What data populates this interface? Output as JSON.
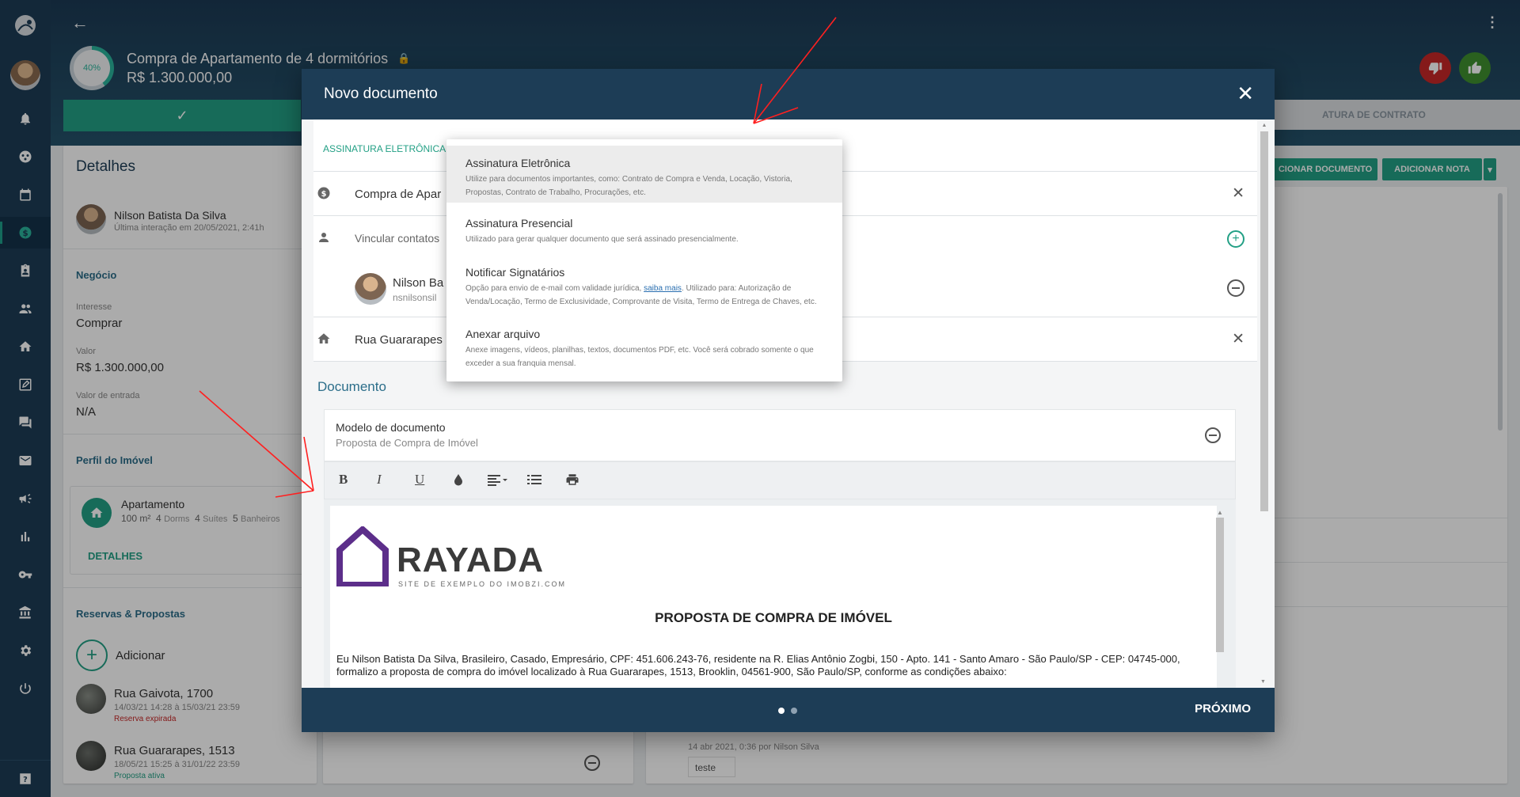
{
  "deal": {
    "title": "Compra de Apartamento de 4 dormitórios",
    "value": "R$ 1.300.000,00",
    "progress": "40%",
    "progress_value": 40
  },
  "topbar_tab_right": "ATURA DE CONTRATO",
  "buttons": {
    "add_document_partial": "CIONAR DOCUMENTO",
    "add_note": "ADICIONAR NOTA"
  },
  "details": {
    "heading": "Detalhes",
    "contact_name": "Nilson Batista Da Silva",
    "last_interaction": "Última interação em 20/05/2021, 2:41h",
    "business_heading": "Negócio",
    "interest_label": "Interesse",
    "interest_value": "Comprar",
    "value_label": "Valor",
    "value_value": "R$ 1.300.000,00",
    "entry_label": "Valor de entrada",
    "entry_value": "N/A",
    "profile_heading": "Perfil do Imóvel",
    "property_type": "Apartamento",
    "property_area": "100 m²",
    "dorms_n": "4",
    "dorms_l": "Dorms",
    "suites_n": "4",
    "suites_l": "Suítes",
    "baths_n": "5",
    "baths_l": "Banheiros",
    "details_link": "DETALHES",
    "reservations_heading": "Reservas & Propostas",
    "add_label": "Adicionar",
    "reservations": [
      {
        "address": "Rua Gaivota, 1700",
        "dates": "14/03/21 14:28 à 15/03/21 23:59",
        "status": "Reserva expirada"
      },
      {
        "address": "Rua Guararapes, 1513",
        "dates": "18/05/21 15:25 à 31/01/22 23:59",
        "status": "Proposta ativa"
      }
    ]
  },
  "timeline": {
    "meta": "14 abr 2021, 0:36 por Nilson Silva",
    "note": "teste"
  },
  "modal": {
    "title": "Novo documento",
    "tab_label": "ASSINATURA ELETRÔNICA",
    "deal_row": "Compra de Apar",
    "link_contacts": "Vincular contatos",
    "contact_name": "Nilson Ba",
    "contact_email": "nsnilsonsil",
    "property_row": "Rua Guararapes",
    "document_heading": "Documento",
    "template_label": "Modelo de documento",
    "template_value": "Proposta de Compra de Imóvel",
    "next_label": "PRÓXIMO"
  },
  "toolbar": {
    "bold": "B",
    "italic": "I",
    "underline": "U"
  },
  "document": {
    "brand": "RAYADA",
    "brand_tagline": "SITE DE EXEMPLO DO IMOBZI.COM",
    "heading": "PROPOSTA DE COMPRA DE IMÓVEL",
    "paragraph": "Eu Nilson Batista Da Silva, Brasileiro, Casado, Empresário, CPF: 451.606.243-76, residente na R. Elias Antônio Zogbi, 150 - Apto. 141 - Santo Amaro - São Paulo/SP - CEP: 04745-000, formalizo a proposta de compra do imóvel localizado à Rua Guararapes, 1513, Brooklin, 04561-900, São Paulo/SP, conforme as condições abaixo:"
  },
  "dropdown": {
    "items": [
      {
        "title": "Assinatura Eletrônica",
        "desc": "Utilize para documentos importantes, como: Contrato de Compra e Venda, Locação, Vistoria, Propostas, Contrato de Trabalho, Procurações, etc."
      },
      {
        "title": "Assinatura Presencial",
        "desc": "Utilizado para gerar qualquer documento que será assinado presencialmente."
      },
      {
        "title": "Notificar Signatários",
        "desc_before": "Opção para envio de e-mail com validade jurídica, ",
        "desc_link": "saiba mais",
        "desc_after": ". Utilizado para: Autorização de Venda/Locação, Termo de Exclusividade, Comprovante de Visita, Termo de Entrega de Chaves, etc."
      },
      {
        "title": "Anexar arquivo",
        "desc": "Anexe imagens, vídeos, planilhas, textos, documentos PDF, etc. Você será cobrado somente o que exceder a sua franquia mensal."
      }
    ]
  },
  "colors": {
    "primary_dark": "#1d3d56",
    "accent_green": "#23a085",
    "danger": "#c62828",
    "arrow": "#ff2020"
  }
}
